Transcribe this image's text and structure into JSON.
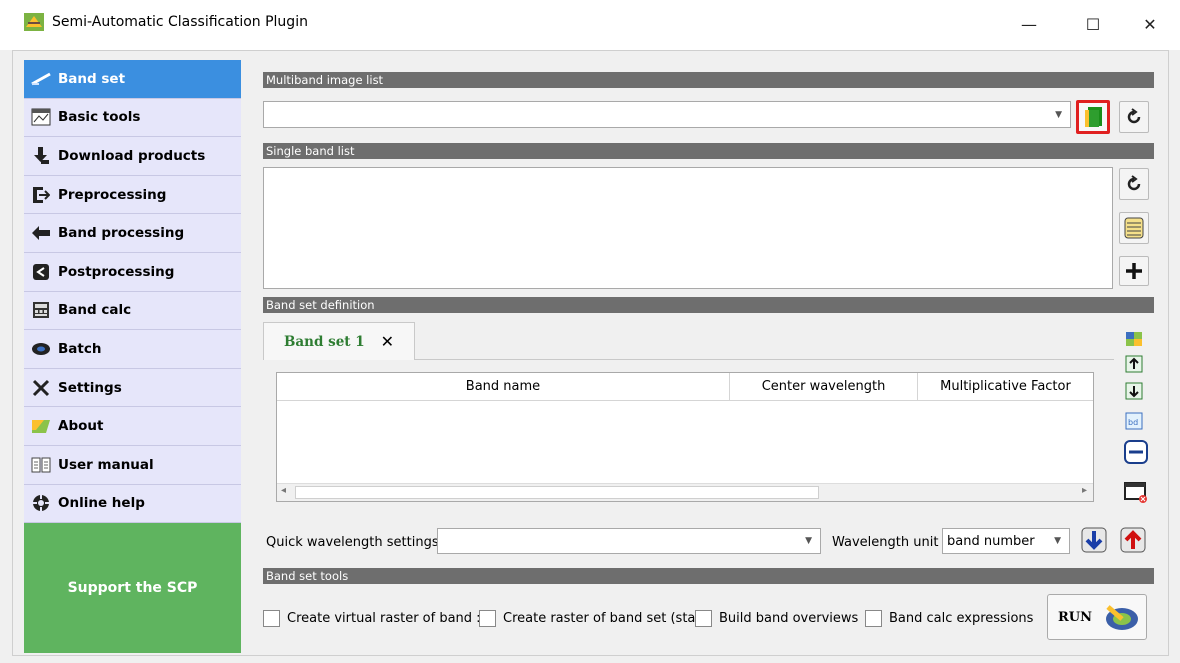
{
  "window": {
    "title": "Semi-Automatic Classification Plugin",
    "minimize_glyph": "—",
    "maximize_glyph": "☐",
    "close_glyph": "✕"
  },
  "sidebar": {
    "items": [
      {
        "label": "Band set",
        "icon": "band-set-icon",
        "active": true
      },
      {
        "label": "Basic tools",
        "icon": "basic-tools-icon"
      },
      {
        "label": "Download products",
        "icon": "download-icon"
      },
      {
        "label": "Preprocessing",
        "icon": "preprocessing-icon"
      },
      {
        "label": "Band processing",
        "icon": "band-processing-icon"
      },
      {
        "label": "Postprocessing",
        "icon": "postprocessing-icon"
      },
      {
        "label": "Band calc",
        "icon": "calculator-icon"
      },
      {
        "label": "Batch",
        "icon": "batch-icon"
      },
      {
        "label": "Settings",
        "icon": "settings-icon"
      },
      {
        "label": "About",
        "icon": "about-icon"
      },
      {
        "label": "User manual",
        "icon": "book-icon"
      },
      {
        "label": "Online help",
        "icon": "help-icon"
      }
    ],
    "support_label": "Support the SCP"
  },
  "multiband": {
    "section_title": "Multiband image list",
    "selected_value": ""
  },
  "single_band": {
    "section_title": "Single band list"
  },
  "band_set_definition": {
    "section_title": "Band set definition",
    "tab_label": "Band set 1",
    "tab_close": "✕",
    "columns": [
      "Band name",
      "Center wavelength",
      "Multiplicative Factor"
    ]
  },
  "wavelength": {
    "quick_label": "Quick wavelength settings",
    "quick_value": "",
    "unit_label": "Wavelength unit",
    "unit_value": "band number"
  },
  "band_set_tools": {
    "section_title": "Band set tools",
    "options": [
      "Create virtual raster of band :",
      "Create raster of band set (sta",
      "Build band overviews",
      "Band calc expressions"
    ],
    "run_label": "RUN"
  },
  "colors": {
    "active_nav": "#3b8fe0",
    "nav_bg": "#e6e6fa",
    "support_bg": "#5fb45f",
    "section_bar": "#6e6e6e",
    "tab_text": "#2e7d32",
    "highlight_border": "#e02020"
  }
}
